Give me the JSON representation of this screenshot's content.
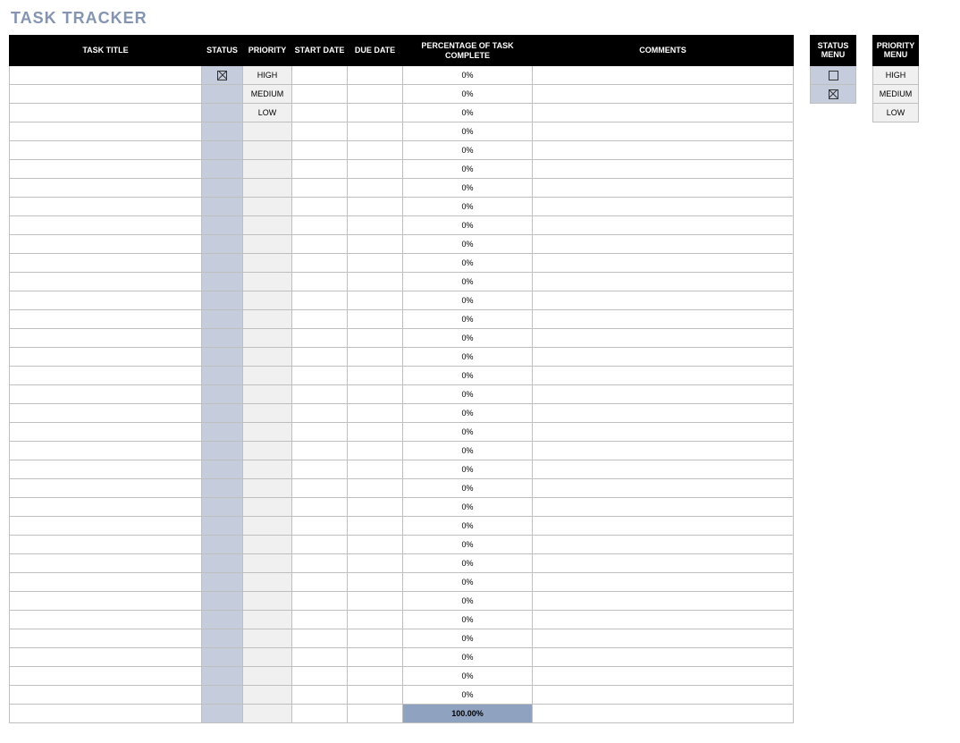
{
  "title": "TASK TRACKER",
  "columns": {
    "task_title": "TASK TITLE",
    "status": "STATUS",
    "priority": "PRIORITY",
    "start_date": "START DATE",
    "due_date": "DUE DATE",
    "pct_complete": "PERCENTAGE OF TASK COMPLETE",
    "comments": "COMMENTS"
  },
  "rows": [
    {
      "task_title": "",
      "status": "checked",
      "priority": "HIGH",
      "start_date": "",
      "due_date": "",
      "pct": "0%",
      "comments": ""
    },
    {
      "task_title": "",
      "status": "",
      "priority": "MEDIUM",
      "start_date": "",
      "due_date": "",
      "pct": "0%",
      "comments": ""
    },
    {
      "task_title": "",
      "status": "",
      "priority": "LOW",
      "start_date": "",
      "due_date": "",
      "pct": "0%",
      "comments": ""
    },
    {
      "task_title": "",
      "status": "",
      "priority": "",
      "start_date": "",
      "due_date": "",
      "pct": "0%",
      "comments": ""
    },
    {
      "task_title": "",
      "status": "",
      "priority": "",
      "start_date": "",
      "due_date": "",
      "pct": "0%",
      "comments": ""
    },
    {
      "task_title": "",
      "status": "",
      "priority": "",
      "start_date": "",
      "due_date": "",
      "pct": "0%",
      "comments": ""
    },
    {
      "task_title": "",
      "status": "",
      "priority": "",
      "start_date": "",
      "due_date": "",
      "pct": "0%",
      "comments": ""
    },
    {
      "task_title": "",
      "status": "",
      "priority": "",
      "start_date": "",
      "due_date": "",
      "pct": "0%",
      "comments": ""
    },
    {
      "task_title": "",
      "status": "",
      "priority": "",
      "start_date": "",
      "due_date": "",
      "pct": "0%",
      "comments": ""
    },
    {
      "task_title": "",
      "status": "",
      "priority": "",
      "start_date": "",
      "due_date": "",
      "pct": "0%",
      "comments": ""
    },
    {
      "task_title": "",
      "status": "",
      "priority": "",
      "start_date": "",
      "due_date": "",
      "pct": "0%",
      "comments": ""
    },
    {
      "task_title": "",
      "status": "",
      "priority": "",
      "start_date": "",
      "due_date": "",
      "pct": "0%",
      "comments": ""
    },
    {
      "task_title": "",
      "status": "",
      "priority": "",
      "start_date": "",
      "due_date": "",
      "pct": "0%",
      "comments": ""
    },
    {
      "task_title": "",
      "status": "",
      "priority": "",
      "start_date": "",
      "due_date": "",
      "pct": "0%",
      "comments": ""
    },
    {
      "task_title": "",
      "status": "",
      "priority": "",
      "start_date": "",
      "due_date": "",
      "pct": "0%",
      "comments": ""
    },
    {
      "task_title": "",
      "status": "",
      "priority": "",
      "start_date": "",
      "due_date": "",
      "pct": "0%",
      "comments": ""
    },
    {
      "task_title": "",
      "status": "",
      "priority": "",
      "start_date": "",
      "due_date": "",
      "pct": "0%",
      "comments": ""
    },
    {
      "task_title": "",
      "status": "",
      "priority": "",
      "start_date": "",
      "due_date": "",
      "pct": "0%",
      "comments": ""
    },
    {
      "task_title": "",
      "status": "",
      "priority": "",
      "start_date": "",
      "due_date": "",
      "pct": "0%",
      "comments": ""
    },
    {
      "task_title": "",
      "status": "",
      "priority": "",
      "start_date": "",
      "due_date": "",
      "pct": "0%",
      "comments": ""
    },
    {
      "task_title": "",
      "status": "",
      "priority": "",
      "start_date": "",
      "due_date": "",
      "pct": "0%",
      "comments": ""
    },
    {
      "task_title": "",
      "status": "",
      "priority": "",
      "start_date": "",
      "due_date": "",
      "pct": "0%",
      "comments": ""
    },
    {
      "task_title": "",
      "status": "",
      "priority": "",
      "start_date": "",
      "due_date": "",
      "pct": "0%",
      "comments": ""
    },
    {
      "task_title": "",
      "status": "",
      "priority": "",
      "start_date": "",
      "due_date": "",
      "pct": "0%",
      "comments": ""
    },
    {
      "task_title": "",
      "status": "",
      "priority": "",
      "start_date": "",
      "due_date": "",
      "pct": "0%",
      "comments": ""
    },
    {
      "task_title": "",
      "status": "",
      "priority": "",
      "start_date": "",
      "due_date": "",
      "pct": "0%",
      "comments": ""
    },
    {
      "task_title": "",
      "status": "",
      "priority": "",
      "start_date": "",
      "due_date": "",
      "pct": "0%",
      "comments": ""
    },
    {
      "task_title": "",
      "status": "",
      "priority": "",
      "start_date": "",
      "due_date": "",
      "pct": "0%",
      "comments": ""
    },
    {
      "task_title": "",
      "status": "",
      "priority": "",
      "start_date": "",
      "due_date": "",
      "pct": "0%",
      "comments": ""
    },
    {
      "task_title": "",
      "status": "",
      "priority": "",
      "start_date": "",
      "due_date": "",
      "pct": "0%",
      "comments": ""
    },
    {
      "task_title": "",
      "status": "",
      "priority": "",
      "start_date": "",
      "due_date": "",
      "pct": "0%",
      "comments": ""
    },
    {
      "task_title": "",
      "status": "",
      "priority": "",
      "start_date": "",
      "due_date": "",
      "pct": "0%",
      "comments": ""
    },
    {
      "task_title": "",
      "status": "",
      "priority": "",
      "start_date": "",
      "due_date": "",
      "pct": "0%",
      "comments": ""
    },
    {
      "task_title": "",
      "status": "",
      "priority": "",
      "start_date": "",
      "due_date": "",
      "pct": "0%",
      "comments": ""
    }
  ],
  "total_pct": "100.00%",
  "status_menu": {
    "header": "STATUS MENU",
    "items": [
      "unchecked",
      "checked"
    ]
  },
  "priority_menu": {
    "header": "PRIORITY MENU",
    "items": [
      "HIGH",
      "MEDIUM",
      "LOW"
    ]
  }
}
